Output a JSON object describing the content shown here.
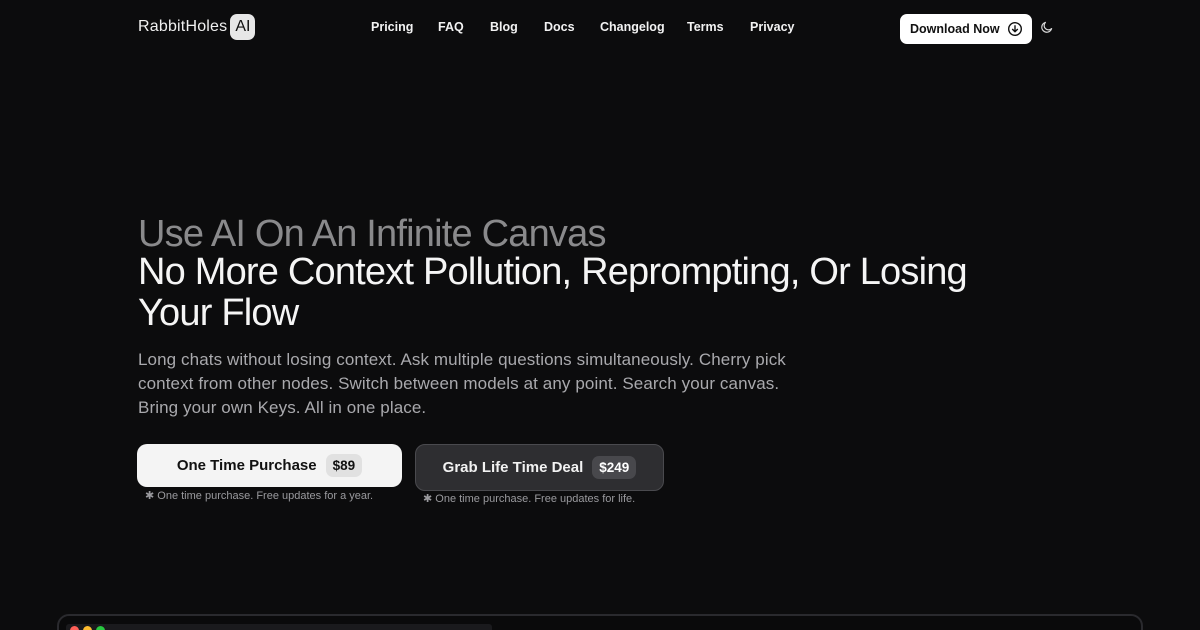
{
  "brand": {
    "name": "RabbitHoles",
    "badge": "AI"
  },
  "nav": {
    "links": [
      "Pricing",
      "FAQ",
      "Blog",
      "Docs",
      "Changelog",
      "Terms",
      "Privacy"
    ],
    "download_label": "Download Now",
    "download_icon": "download-circle-icon",
    "theme_icon": "moon-icon"
  },
  "hero": {
    "line1": "Use AI On An Infinite Canvas",
    "line2": "No More Context Pollution, Reprompting, Or Losing Your Flow",
    "subtitle": "Long chats without losing context. Ask multiple questions simultaneously. Cherry pick context from other nodes. Switch between models at any point. Search your canvas. Bring your own Keys. All in one place."
  },
  "cta": {
    "one_time": {
      "label": "One Time Purchase",
      "price": "$89",
      "note": "✱ One time purchase. Free updates for a year."
    },
    "lifetime": {
      "label": "Grab Life Time Deal",
      "price": "$249",
      "note": "✱ One time purchase. Free updates for life."
    }
  },
  "colors": {
    "background": "#0c0c0d",
    "text": "#f5f5f5",
    "muted": "#8a8a8c"
  }
}
